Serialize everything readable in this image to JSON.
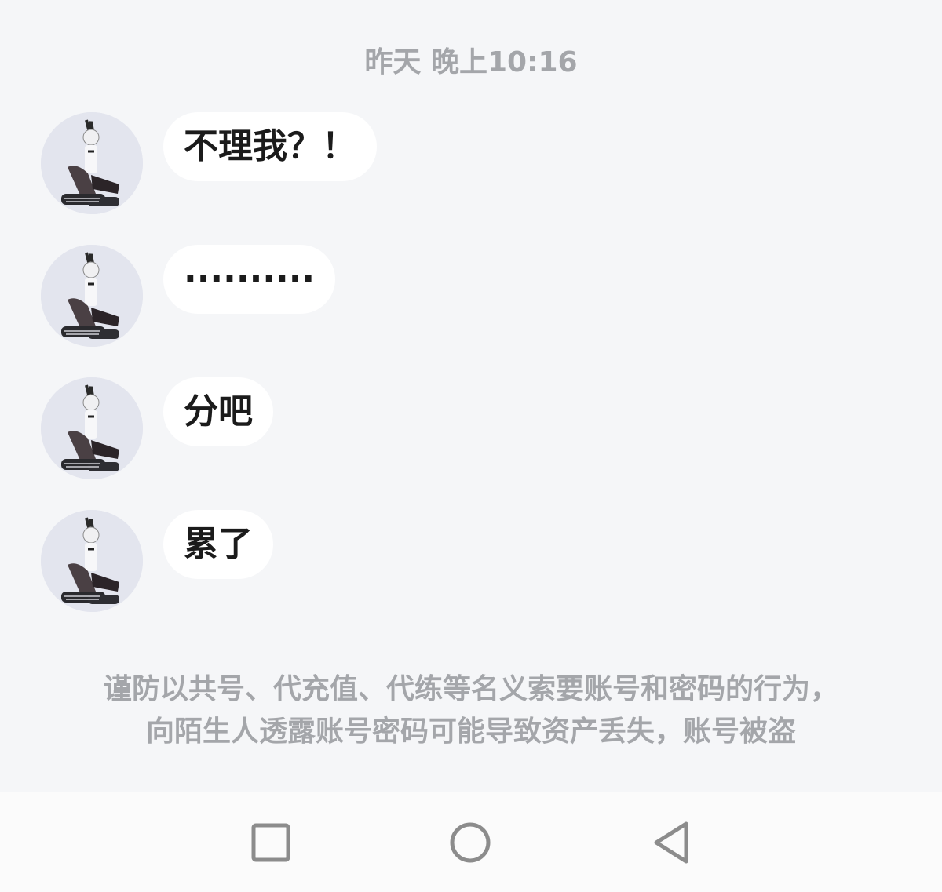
{
  "timestamp": "昨天 晚上10:16",
  "messages": [
    {
      "text": "不理我？！"
    },
    {
      "text": "··········"
    },
    {
      "text": "分吧"
    },
    {
      "text": "累了"
    }
  ],
  "notice": {
    "line1": "谨防以共号、代充值、代练等名义索要账号和密码的行为，",
    "line2": "向陌生人透露账号密码可能导致资产丢失，账号被盗"
  },
  "nav": {
    "icons": [
      "recent-apps-icon",
      "home-icon",
      "back-icon"
    ]
  },
  "colors": {
    "background": "#f5f6f8",
    "bubble": "#ffffff",
    "muted_text": "#a4a6aa",
    "message_text": "#1b1b1b"
  }
}
